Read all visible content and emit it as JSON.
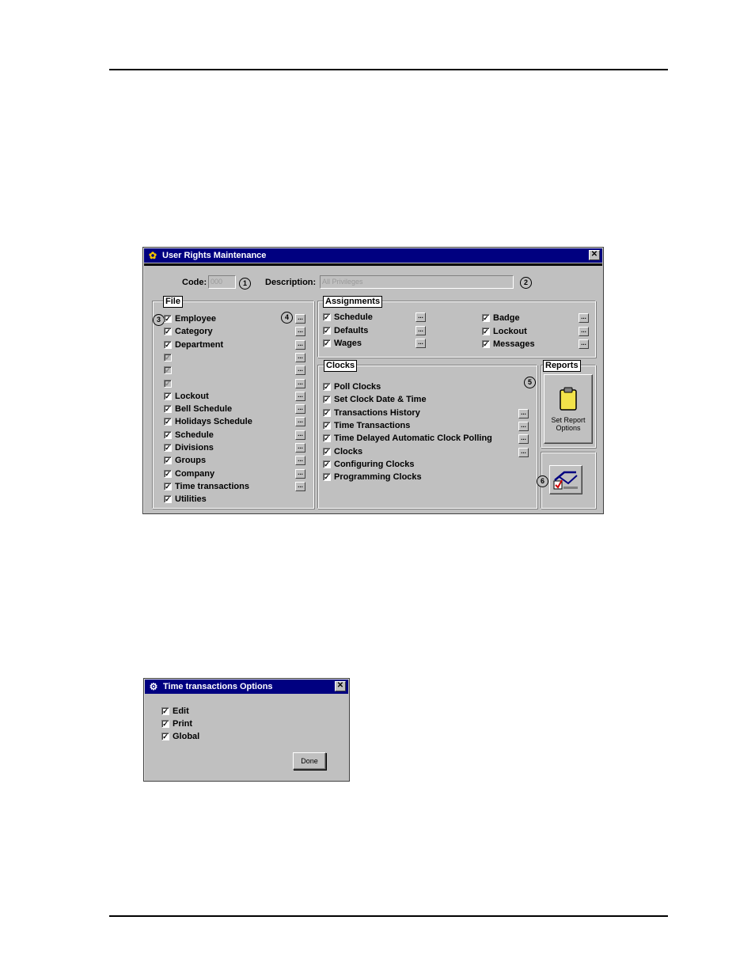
{
  "main_window": {
    "title": "User Rights Maintenance",
    "close_glyph": "✕",
    "code_label": "Code:",
    "code_value": "000",
    "description_label": "Description:",
    "description_value": "All Privileges",
    "callouts": [
      "1",
      "2",
      "3",
      "4",
      "5",
      "6"
    ],
    "file_group": {
      "title": "File",
      "items": [
        {
          "label": "Employee",
          "checked": true
        },
        {
          "label": "Category",
          "checked": true
        },
        {
          "label": "Department",
          "checked": true
        },
        {
          "label": "",
          "checked": true,
          "disabled": true
        },
        {
          "label": "",
          "checked": true,
          "disabled": true
        },
        {
          "label": "",
          "checked": true,
          "disabled": true
        },
        {
          "label": "Lockout",
          "checked": true
        },
        {
          "label": "Bell Schedule",
          "checked": true
        },
        {
          "label": "Holidays Schedule",
          "checked": true
        },
        {
          "label": "Schedule",
          "checked": true
        },
        {
          "label": "Divisions",
          "checked": true
        },
        {
          "label": "Groups",
          "checked": true
        },
        {
          "label": "Company",
          "checked": true
        },
        {
          "label": "Time transactions",
          "checked": true
        },
        {
          "label": "Utilities",
          "checked": true
        }
      ],
      "ellipsis_label": "..."
    },
    "assignments_group": {
      "title": "Assignments",
      "left_items": [
        "Schedule",
        "Defaults",
        "Wages"
      ],
      "right_items": [
        "Badge",
        "Lockout",
        "Messages"
      ]
    },
    "clocks_group": {
      "title": "Clocks",
      "items": [
        "Poll Clocks",
        "Set Clock Date & Time",
        "Transactions History",
        "Time Transactions",
        "Time Delayed Automatic Clock Polling",
        "Clocks",
        "Configuring Clocks",
        "Programming Clocks"
      ]
    },
    "reports_group": {
      "title": "Reports",
      "button_label_line1": "Set Report",
      "button_label_line2": "Options"
    }
  },
  "options_window": {
    "title": "Time transactions Options",
    "close_glyph": "✕",
    "items": [
      "Edit",
      "Print",
      "Global"
    ],
    "done_label": "Done"
  },
  "colors": {
    "titlebar": "#000080",
    "window_face": "#c0c0c0",
    "check_mark": "#000000"
  }
}
